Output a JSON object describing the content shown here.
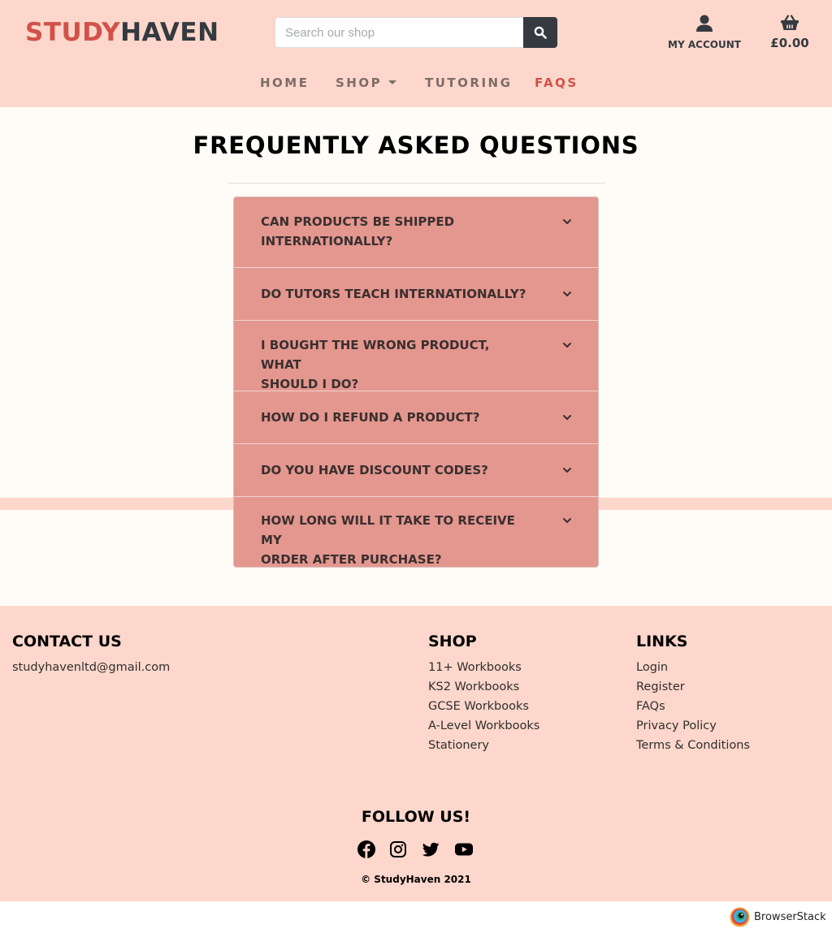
{
  "brand": {
    "part1": "STUDY",
    "part2": "HAVEN",
    "color_primary": "#d1524a",
    "color_dark": "#343a40"
  },
  "search": {
    "placeholder": "Search our shop",
    "value": "",
    "icon": "search-icon"
  },
  "account": {
    "label": "MY ACCOUNT",
    "icon": "user-icon"
  },
  "bag": {
    "total": "£0.00",
    "icon": "basket-icon"
  },
  "nav": {
    "home": "HOME",
    "shop": "SHOP",
    "tutoring": "TUTORING",
    "faqs": "FAQS",
    "active": "FAQS"
  },
  "page": {
    "title": "FREQUENTLY ASKED QUESTIONS"
  },
  "faqs": [
    {
      "q1": "CAN PRODUCTS BE SHIPPED",
      "q2": "INTERNATIONALLY?"
    },
    {
      "q1": "DO TUTORS TEACH INTERNATIONALLY?",
      "q2": ""
    },
    {
      "q1": "I BOUGHT THE WRONG PRODUCT, WHAT",
      "q2": "SHOULD I DO?"
    },
    {
      "q1": "HOW DO I REFUND A PRODUCT?",
      "q2": ""
    },
    {
      "q1": "DO YOU HAVE DISCOUNT CODES?",
      "q2": ""
    },
    {
      "q1": "HOW LONG WILL IT TAKE TO RECEIVE MY",
      "q2": "ORDER AFTER PURCHASE?"
    }
  ],
  "footer": {
    "contact": {
      "heading": "CONTACT US",
      "email": "studyhavenltd@gmail.com"
    },
    "shop": {
      "heading": "SHOP",
      "links": [
        "11+ Workbooks",
        "KS2 Workbooks",
        "GCSE Workbooks",
        "A-Level Workbooks",
        "Stationery"
      ]
    },
    "links": {
      "heading": "LINKS",
      "links": [
        "Login",
        "Register",
        "FAQs",
        "Privacy Policy",
        "Terms & Conditions"
      ]
    },
    "follow": "FOLLOW US!",
    "social": [
      "facebook-icon",
      "instagram-icon",
      "twitter-icon",
      "youtube-icon"
    ],
    "copyright": "© StudyHaven 2021"
  },
  "badge": {
    "label": "BrowserStack"
  },
  "colors": {
    "header_bg": "#fdd7cb",
    "main_bg": "#fffcf8",
    "accordion_bg": "#e3978f"
  }
}
